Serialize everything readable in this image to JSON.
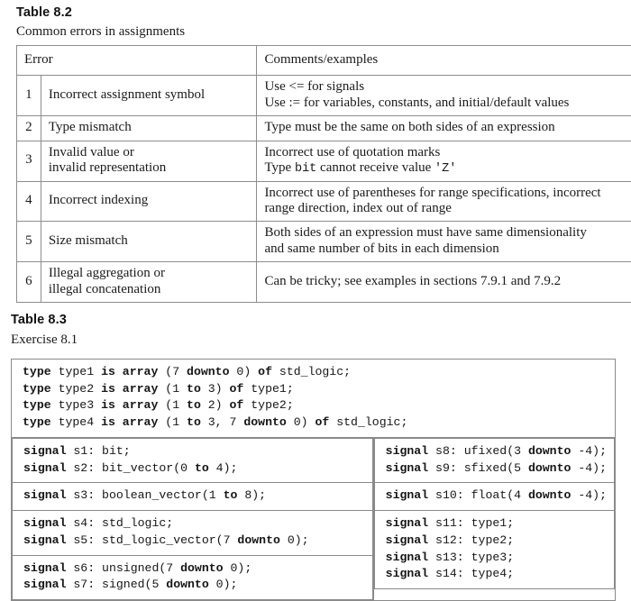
{
  "table_82": {
    "label": "Table 8.2",
    "caption": "Common errors in assignments",
    "headers": {
      "error": "Error",
      "comments": "Comments/examples"
    },
    "rows": [
      {
        "num": "1",
        "desc_lines": [
          "Incorrect assignment symbol"
        ],
        "comment_lines": [
          "Use <= for signals",
          "Use := for variables, constants, and initial/default values"
        ]
      },
      {
        "num": "2",
        "desc_lines": [
          "Type mismatch"
        ],
        "comment_lines": [
          "Type must be the same on both sides of an expression"
        ]
      },
      {
        "num": "3",
        "desc_lines": [
          "Invalid value or",
          "invalid representation"
        ],
        "comment_lines": [
          "Incorrect use of quotation marks",
          "Type bit cannot receive value 'Z'"
        ],
        "comment_mono": [
          "bit",
          "'Z'"
        ]
      },
      {
        "num": "4",
        "desc_lines": [
          "Incorrect indexing"
        ],
        "comment_lines": [
          "Incorrect use of parentheses for range specifications, incorrect",
          "range direction, index out of range"
        ]
      },
      {
        "num": "5",
        "desc_lines": [
          "Size mismatch"
        ],
        "comment_lines": [
          "Both sides of an expression must have same dimensionality",
          "and same number of bits in each dimension"
        ]
      },
      {
        "num": "6",
        "desc_lines": [
          "Illegal aggregation or",
          "illegal concatenation"
        ],
        "comment_lines": [
          "Can be tricky; see examples in sections 7.9.1 and 7.9.2"
        ]
      }
    ]
  },
  "table_83": {
    "label": "Table 8.3",
    "caption": "Exercise 8.1",
    "type_declarations": [
      "type type1 is array (7 downto 0) of std_logic;",
      "type type2 is array (1 to 3) of type1;",
      "type type3 is array (1 to 2) of type2;",
      "type type4 is array (1 to 3, 7 downto 0) of std_logic;"
    ],
    "signals_left": [
      [
        "signal s1: bit;",
        "signal s2: bit_vector(0 to 4);"
      ],
      [
        "signal s3: boolean_vector(1 to 8);"
      ],
      [
        "signal s4: std_logic;",
        "signal s5: std_logic_vector(7 downto 0);"
      ],
      [
        "signal s6: unsigned(7 downto 0);",
        "signal s7: signed(5 downto 0);"
      ]
    ],
    "signals_right": [
      [
        "signal s8: ufixed(3 downto -4);",
        "signal s9: sfixed(5 downto -4);"
      ],
      [
        "signal s10: float(4 downto -4);"
      ],
      [
        "signal s11: type1;",
        "signal s12: type2;",
        "signal s13: type3;",
        "signal s14: type4;"
      ]
    ],
    "keywords": [
      "type",
      "is",
      "array",
      "downto",
      "to",
      "of",
      "signal"
    ]
  },
  "colors": {
    "border": "#8a8a8a",
    "text": "#161616",
    "background": "#ffffff"
  }
}
